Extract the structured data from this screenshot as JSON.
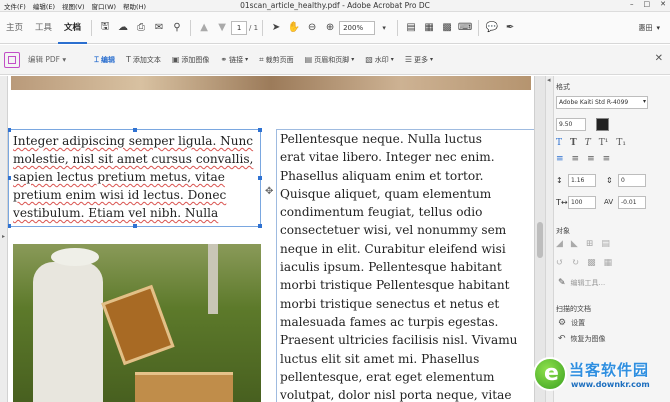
{
  "window": {
    "title": "01scan_article_healthy.pdf - Adobe Acrobat Pro DC",
    "menus": [
      "文件(F)",
      "编辑(E)",
      "视图(V)",
      "窗口(W)",
      "帮助(H)"
    ],
    "controls": [
      "–",
      "□",
      "✕"
    ]
  },
  "tabs": [
    "主页",
    "工具",
    "文档"
  ],
  "toolbar": {
    "page_current": "1",
    "page_total": "/ 1",
    "zoom": "200%",
    "signin_label": "惠田"
  },
  "editbar": {
    "title": "编辑 PDF",
    "items": [
      {
        "label": "编辑",
        "icon": "edit-cursor-icon",
        "glyph": "⌶"
      },
      {
        "label": "添加文本",
        "icon": "add-text-icon",
        "glyph": "T"
      },
      {
        "label": "添加图像",
        "icon": "add-image-icon",
        "glyph": "▣"
      },
      {
        "label": "链接",
        "icon": "link-icon",
        "glyph": "⚭"
      },
      {
        "label": "裁剪页面",
        "icon": "crop-icon",
        "glyph": "⌗"
      },
      {
        "label": "页眉和页脚",
        "icon": "header-footer-icon",
        "glyph": "▤"
      },
      {
        "label": "水印",
        "icon": "watermark-icon",
        "glyph": "▧"
      },
      {
        "label": "更多",
        "icon": "more-icon",
        "glyph": "☰"
      }
    ]
  },
  "document": {
    "col1": [
      "Integer adipiscing semper ligula. Nunc",
      "molestie, nisl sit amet cursus convallis,",
      "sapien lectus pretium metus, vitae",
      "pretium enim wisi id lectus. Donec",
      "vestibulum. Etiam vel nibh. Nulla"
    ],
    "col2": [
      "Pellentesque neque. Nulla luctus",
      "erat vitae libero. Integer nec enim.",
      "Phasellus aliquam enim et tortor.",
      "Quisque aliquet, quam elementum",
      "condimentum feugiat, tellus odio",
      "consectetuer wisi, vel nonummy sem",
      "neque in elit. Curabitur eleifend wisi",
      "iaculis ipsum. Pellentesque habitant",
      "morbi tristique Pellentesque habitant",
      "morbi tristique senectus et netus et",
      "malesuada fames ac turpis egestas.",
      "Praesent ultricies facilisis nisl. Vivamu",
      "luctus elit sit amet mi. Phasellus",
      "pellentesque, erat eget elementum",
      "volutpat, dolor nisl porta neque, vitae"
    ]
  },
  "panel": {
    "format_heading": "格式",
    "font": "Adobe Kaiti Std R-4099",
    "size": "9.50",
    "line_spacing": "1.16",
    "para_spacing": "0",
    "h_scale": "100",
    "char_spacing": "-0.01",
    "objects_heading": "对象",
    "edit_tool": "编辑工具...",
    "scan_heading": "扫描的文档",
    "settings_label": "设置",
    "restore_label": "恢复为图像"
  },
  "watermark": {
    "brand": "当客软件园",
    "url": "www.downkr.com"
  }
}
